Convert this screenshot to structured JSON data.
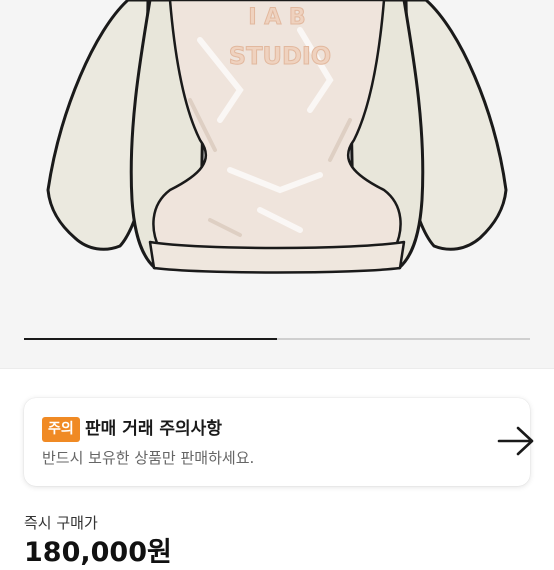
{
  "product_image": {
    "print_text_top": "I A B",
    "print_text_bottom": "STUDIO",
    "slide_progress": 0.5
  },
  "notice": {
    "badge": "주의",
    "title": "판매 거래 주의사항",
    "subtitle": "반드시 보유한 상품만 판매하세요.",
    "arrow_icon": "arrow-right-icon"
  },
  "price": {
    "label": "즉시 구매가",
    "value": "180,000원"
  },
  "colors": {
    "badge": "#f08a24",
    "background": "#f5f5f5"
  }
}
